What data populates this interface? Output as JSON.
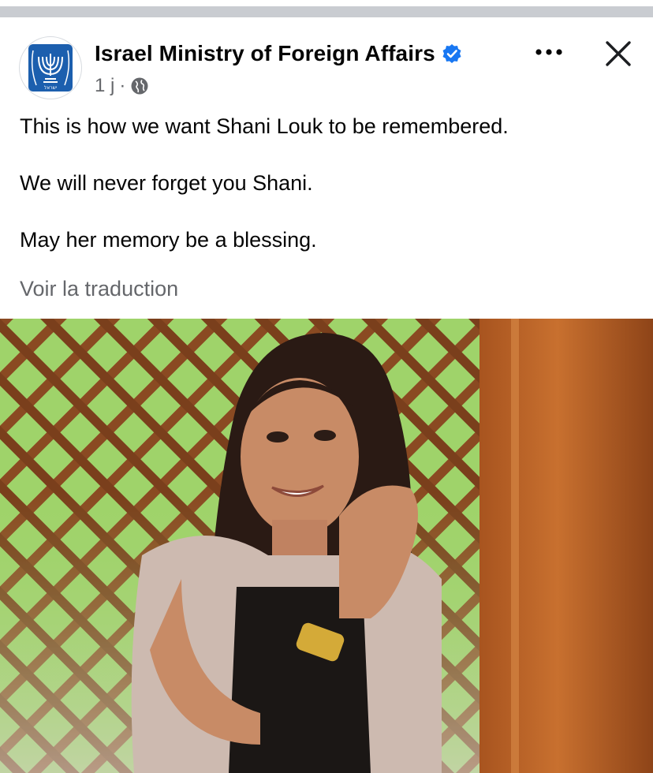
{
  "post": {
    "page_name": "Israel Ministry of Foreign Affairs",
    "timestamp": "1 j",
    "separator": "·",
    "text_lines": [
      "This is how we want Shani Louk to be remembered.",
      "We will never forget you Shani.",
      "May her memory be a blessing."
    ],
    "translate_label": "Voir la traduction"
  },
  "colors": {
    "verified": "#1877f2",
    "emblem": "#1c5fae",
    "secondary_text": "#65676b"
  },
  "icons": {
    "verified": "verified-badge-icon",
    "privacy": "globe-icon",
    "more": "more-options-icon",
    "close": "close-icon"
  }
}
